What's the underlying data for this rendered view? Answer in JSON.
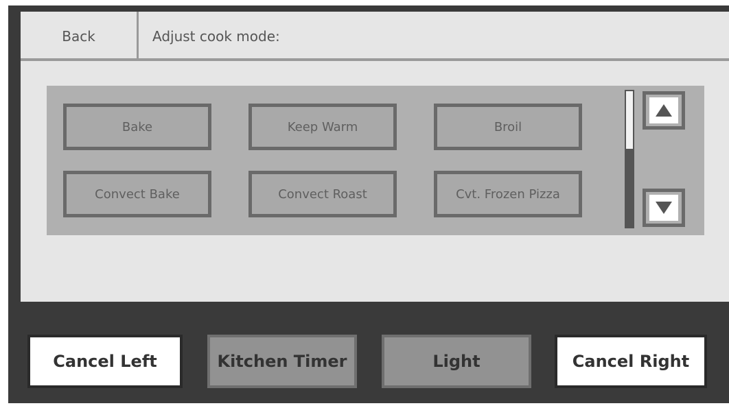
{
  "header": {
    "back_label": "Back",
    "title": "Adjust cook mode:"
  },
  "modes": [
    {
      "label": "Bake"
    },
    {
      "label": "Keep Warm"
    },
    {
      "label": "Broil"
    },
    {
      "label": "Convect Bake"
    },
    {
      "label": "Convect Roast"
    },
    {
      "label": "Cvt. Frozen Pizza"
    }
  ],
  "scroll": {
    "up_icon": "arrow-up-icon",
    "down_icon": "arrow-down-icon"
  },
  "bottom_bar": {
    "cancel_left": "Cancel Left",
    "kitchen_timer": "Kitchen Timer",
    "light": "Light",
    "cancel_right": "Cancel Right"
  }
}
